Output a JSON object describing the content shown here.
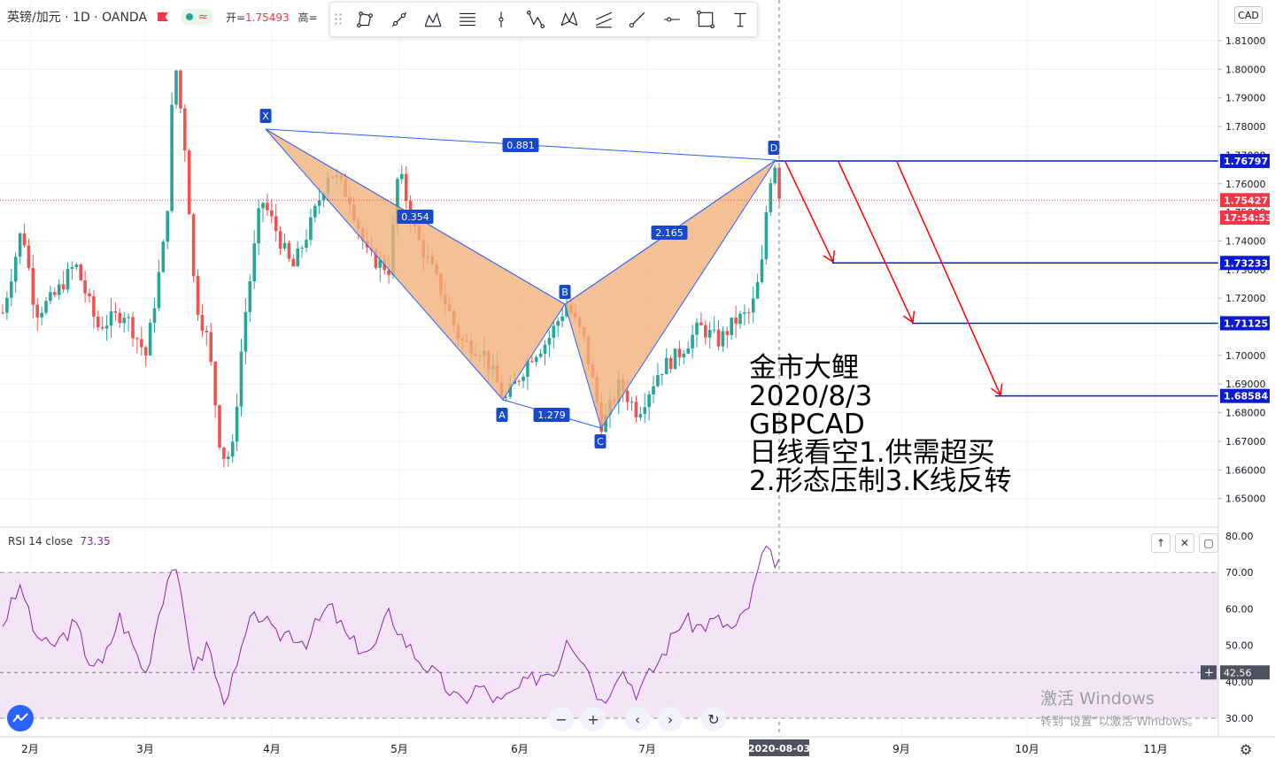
{
  "header": {
    "symbol": "英镑/加元 · 1D · OANDA",
    "approx_icon": "≈",
    "open_label": "开=",
    "open_value": "1.75493",
    "high_label": "高="
  },
  "toolbar": {
    "tools": [
      "rectangle-path-icon",
      "trend-line-icon",
      "pattern-icon",
      "fib-lines-icon",
      "vertical-line-icon",
      "abcd-pattern-icon",
      "xabcd-pattern-icon",
      "channel-icon",
      "ray-icon",
      "horizontal-line-icon",
      "rectangle-icon",
      "text-icon"
    ]
  },
  "currency_button": "CAD",
  "price_axis": {
    "labels": [
      "1.81000",
      "1.80000",
      "1.79000",
      "1.78000",
      "1.77000",
      "1.76000",
      "1.75000",
      "1.74000",
      "1.73000",
      "1.72000",
      "1.71000",
      "1.70000",
      "1.69000",
      "1.68000",
      "1.67000",
      "1.66000",
      "1.65000"
    ],
    "markers": [
      {
        "label": "1.76797",
        "color": "#0c1ad0"
      },
      {
        "label": "1.75427",
        "color": "#f23645"
      },
      {
        "label": "17:54:53",
        "color": "#f23645"
      },
      {
        "label": "1.73233",
        "color": "#0c1ad0"
      },
      {
        "label": "1.71125",
        "color": "#0c1ad0"
      },
      {
        "label": "1.68584",
        "color": "#0c1ad0"
      }
    ]
  },
  "time_axis": {
    "labels": [
      "2月",
      "3月",
      "4月",
      "5月",
      "6月",
      "7月",
      "9月",
      "10月",
      "11月"
    ],
    "current_date": "2020-08-03"
  },
  "pattern": {
    "points": [
      "X",
      "A",
      "B",
      "C",
      "D"
    ],
    "ratios": [
      "0.881",
      "0.354",
      "1.279",
      "2.165"
    ]
  },
  "note": {
    "lines": [
      "金市大鲤",
      "2020/8/3",
      "GBPCAD",
      "日线看空1.供需超买",
      "2.形态压制3.K线反转"
    ]
  },
  "rsi": {
    "title": "RSI 14 close",
    "value": "73.35",
    "axis_labels": [
      "80.00",
      "70.00",
      "60.00",
      "50.00",
      "40.00",
      "30.00"
    ],
    "crosshair_value": "42.56",
    "buttons": [
      "↑",
      "✕",
      "▢"
    ]
  },
  "nav_buttons": [
    "−",
    "+",
    "‹",
    "›",
    "↻"
  ],
  "watermark": {
    "line1": "激活 Windows",
    "line2": "转到“设置”以激活 Windows。"
  },
  "colors": {
    "up": "#26a69a",
    "down": "#ef5350",
    "pattern_fill": "#f0b27a",
    "pattern_line": "#2962ff",
    "target_line": "#0c1ad0",
    "arrow": "#ff0000",
    "rsi_line": "#8e24aa",
    "rsi_band": "#f3e5f5"
  }
}
